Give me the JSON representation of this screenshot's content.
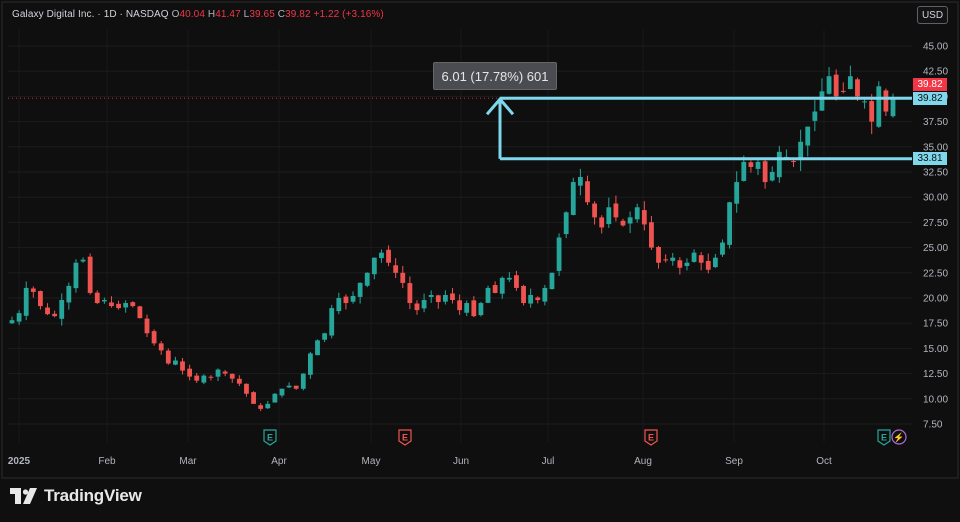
{
  "legend": {
    "symbol": "Galaxy Digital Inc.",
    "interval": "1D",
    "exchange": "NASDAQ",
    "open_label": "O",
    "open": "40.04",
    "high_label": "H",
    "high": "41.47",
    "low_label": "L",
    "low": "39.65",
    "close_label": "C",
    "close": "39.82",
    "change": "+1.22 (+3.16%)"
  },
  "currency": "USD",
  "measure": {
    "label": "6.01 (17.78%) 601",
    "from_price": 33.81,
    "to_price": 39.82,
    "from_tag": "33.81",
    "to_tag": "39.82"
  },
  "last_price": {
    "value": 39.82,
    "tag": "39.82"
  },
  "branding": "TradingView",
  "colors": {
    "background": "#0f0f0f",
    "up": "#26a69a",
    "down": "#ef5350",
    "measure": "#7fd7ec",
    "last_price": "#f23645"
  },
  "chart_data": {
    "type": "candlestick",
    "y_axis": {
      "min": 5,
      "max": 47.5,
      "ticks": [
        "45.00",
        "42.50",
        "40.00",
        "37.50",
        "35.00",
        "32.50",
        "30.00",
        "27.50",
        "25.00",
        "22.50",
        "20.00",
        "17.50",
        "15.00",
        "12.50",
        "10.00",
        "7.50"
      ]
    },
    "x_axis": {
      "labels": [
        "2025",
        "Feb",
        "Mar",
        "Apr",
        "May",
        "Jun",
        "Jul",
        "Aug",
        "Sep",
        "Oct"
      ]
    },
    "events": [
      {
        "label": "E",
        "type": "earnings",
        "color": "#26a69a",
        "after_month": "Mar"
      },
      {
        "label": "E",
        "type": "earnings",
        "color": "#ef5350",
        "after_month": "Apr"
      },
      {
        "label": "E",
        "type": "earnings",
        "color": "#ef5350",
        "after_month": "Jul"
      },
      {
        "label": "E",
        "type": "earnings",
        "color": "#26a69a",
        "after_month": "Oct"
      },
      {
        "label": "⚡",
        "type": "dividend",
        "color": "#b06ad8",
        "after_month": "Oct"
      }
    ],
    "close_path": [
      17.8,
      18.5,
      21.0,
      20.6,
      19.2,
      18.4,
      18.2,
      19.8,
      21.2,
      23.5,
      23.8,
      20.5,
      19.5,
      19.8,
      19.2,
      19.0,
      19.5,
      19.2,
      18.0,
      16.5,
      15.5,
      14.8,
      13.5,
      13.8,
      12.8,
      12.2,
      11.8,
      12.3,
      12.1,
      12.9,
      12.5,
      12.0,
      11.5,
      10.5,
      9.5,
      9.0,
      9.5,
      10.5,
      11.0,
      11.3,
      11.0,
      12.5,
      14.5,
      15.8,
      16.5,
      19.0,
      20.0,
      19.5,
      20.2,
      21.5,
      22.5,
      24.0,
      24.5,
      23.5,
      22.5,
      21.5,
      19.5,
      18.8,
      19.8,
      20.3,
      19.6,
      20.3,
      19.8,
      18.8,
      19.5,
      18.2,
      19.5,
      21.0,
      20.5,
      22.0,
      22.0,
      21.0,
      19.5,
      20.3,
      19.8,
      21.0,
      22.5,
      26.0,
      28.5,
      31.5,
      32.0,
      29.5,
      28.0,
      27.0,
      29.0,
      28.0,
      27.2,
      28.0,
      29.0,
      27.3,
      25.0,
      23.5,
      23.8,
      24.0,
      23.0,
      23.5,
      24.5,
      23.5,
      22.8,
      24.0,
      25.5,
      29.5,
      31.5,
      33.5,
      33.0,
      33.5,
      31.5,
      32.5,
      34.5,
      34.0,
      33.5,
      35.5,
      37.0,
      38.5,
      40.5,
      42.0,
      40.0,
      40.5,
      42.0,
      40.0,
      39.5,
      37.5,
      41.0,
      38.5,
      39.82
    ]
  }
}
